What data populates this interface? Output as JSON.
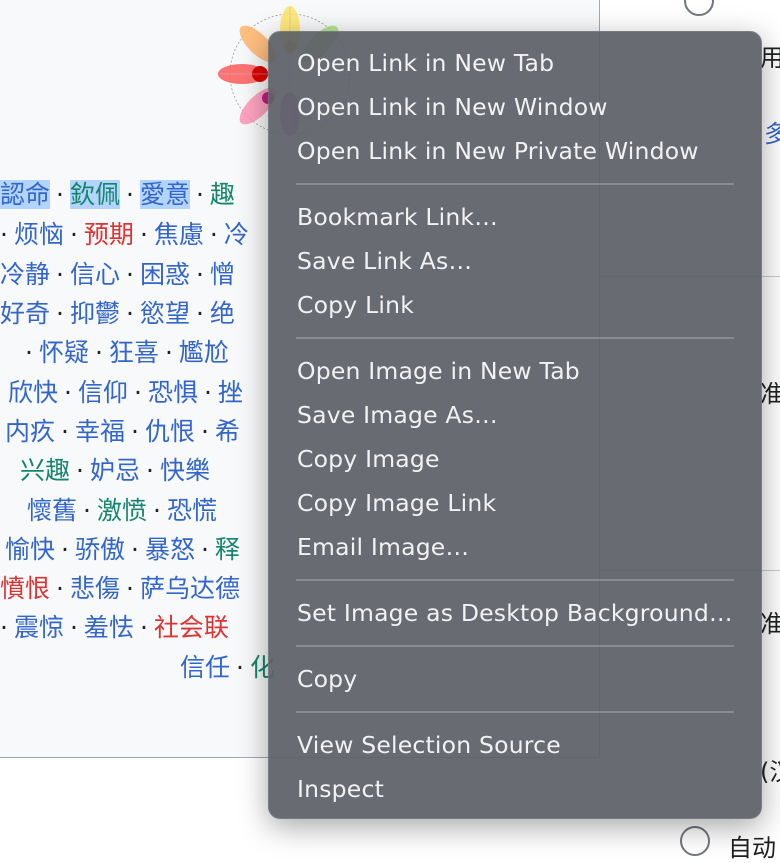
{
  "tag_rows": [
    [
      {
        "t": "認命",
        "c": "blue",
        "sel": true
      },
      {
        "t": "欽佩",
        "c": "green",
        "sel": true
      },
      {
        "t": "愛意",
        "c": "blue",
        "sel": true
      },
      {
        "t": "趣",
        "c": "green"
      }
    ],
    [
      {
        "t": "烦恼",
        "c": "blue"
      },
      {
        "t": "预期",
        "c": "red"
      },
      {
        "t": "焦慮",
        "c": "blue"
      },
      {
        "t": "冷",
        "c": "blue"
      }
    ],
    [
      {
        "t": "冷静",
        "c": "blue"
      },
      {
        "t": "信心",
        "c": "blue"
      },
      {
        "t": "困惑",
        "c": "blue"
      },
      {
        "t": "憎",
        "c": "blue"
      }
    ],
    [
      {
        "t": "好奇",
        "c": "blue"
      },
      {
        "t": "抑鬱",
        "c": "blue"
      },
      {
        "t": "慾望",
        "c": "blue"
      },
      {
        "t": "绝",
        "c": "blue"
      }
    ],
    [
      {
        "t": "怀疑",
        "c": "blue"
      },
      {
        "t": "狂喜",
        "c": "blue"
      },
      {
        "t": "尷尬",
        "c": "blue"
      }
    ],
    [
      {
        "t": "欣快",
        "c": "blue"
      },
      {
        "t": "信仰",
        "c": "blue"
      },
      {
        "t": "恐惧",
        "c": "blue"
      },
      {
        "t": "挫",
        "c": "blue"
      }
    ],
    [
      {
        "t": "内疚",
        "c": "blue"
      },
      {
        "t": "幸福",
        "c": "blue"
      },
      {
        "t": "仇恨",
        "c": "blue"
      },
      {
        "t": "希",
        "c": "blue"
      }
    ],
    [
      {
        "t": "兴趣",
        "c": "green"
      },
      {
        "t": "妒忌",
        "c": "blue"
      },
      {
        "t": "快樂",
        "c": "blue"
      }
    ],
    [
      {
        "t": "懷舊",
        "c": "blue"
      },
      {
        "t": "激愤",
        "c": "green"
      },
      {
        "t": "恐慌",
        "c": "blue"
      }
    ],
    [
      {
        "t": "愉快",
        "c": "blue"
      },
      {
        "t": "骄傲",
        "c": "blue"
      },
      {
        "t": "暴怒",
        "c": "blue"
      },
      {
        "t": "释",
        "c": "green"
      }
    ],
    [
      {
        "t": "憤恨",
        "c": "red"
      },
      {
        "t": "悲傷",
        "c": "blue"
      },
      {
        "t": "萨乌达德",
        "c": "blue"
      }
    ],
    [
      {
        "t": "震惊",
        "c": "blue"
      },
      {
        "t": "羞怯",
        "c": "blue"
      },
      {
        "t": "社会联",
        "c": "red"
      }
    ],
    [
      {
        "t": "信任",
        "c": "blue"
      },
      {
        "t": "化",
        "c": "green"
      }
    ]
  ],
  "right_panel": {
    "t1": "用",
    "t2": "多",
    "t3": "准",
    "t4": "准",
    "t5": "(汉",
    "t6": "自动"
  },
  "menu": {
    "groups": [
      [
        "Open Link in New Tab",
        "Open Link in New Window",
        "Open Link in New Private Window"
      ],
      [
        "Bookmark Link…",
        "Save Link As…",
        "Copy Link"
      ],
      [
        "Open Image in New Tab",
        "Save Image As…",
        "Copy Image",
        "Copy Image Link",
        "Email Image…"
      ],
      [
        "Set Image as Desktop Background…"
      ],
      [
        "Copy"
      ],
      [
        "View Selection Source",
        "Inspect"
      ]
    ]
  },
  "colors": {
    "blue": "#3366cc",
    "green": "#14866d",
    "red": "#dd3333"
  }
}
